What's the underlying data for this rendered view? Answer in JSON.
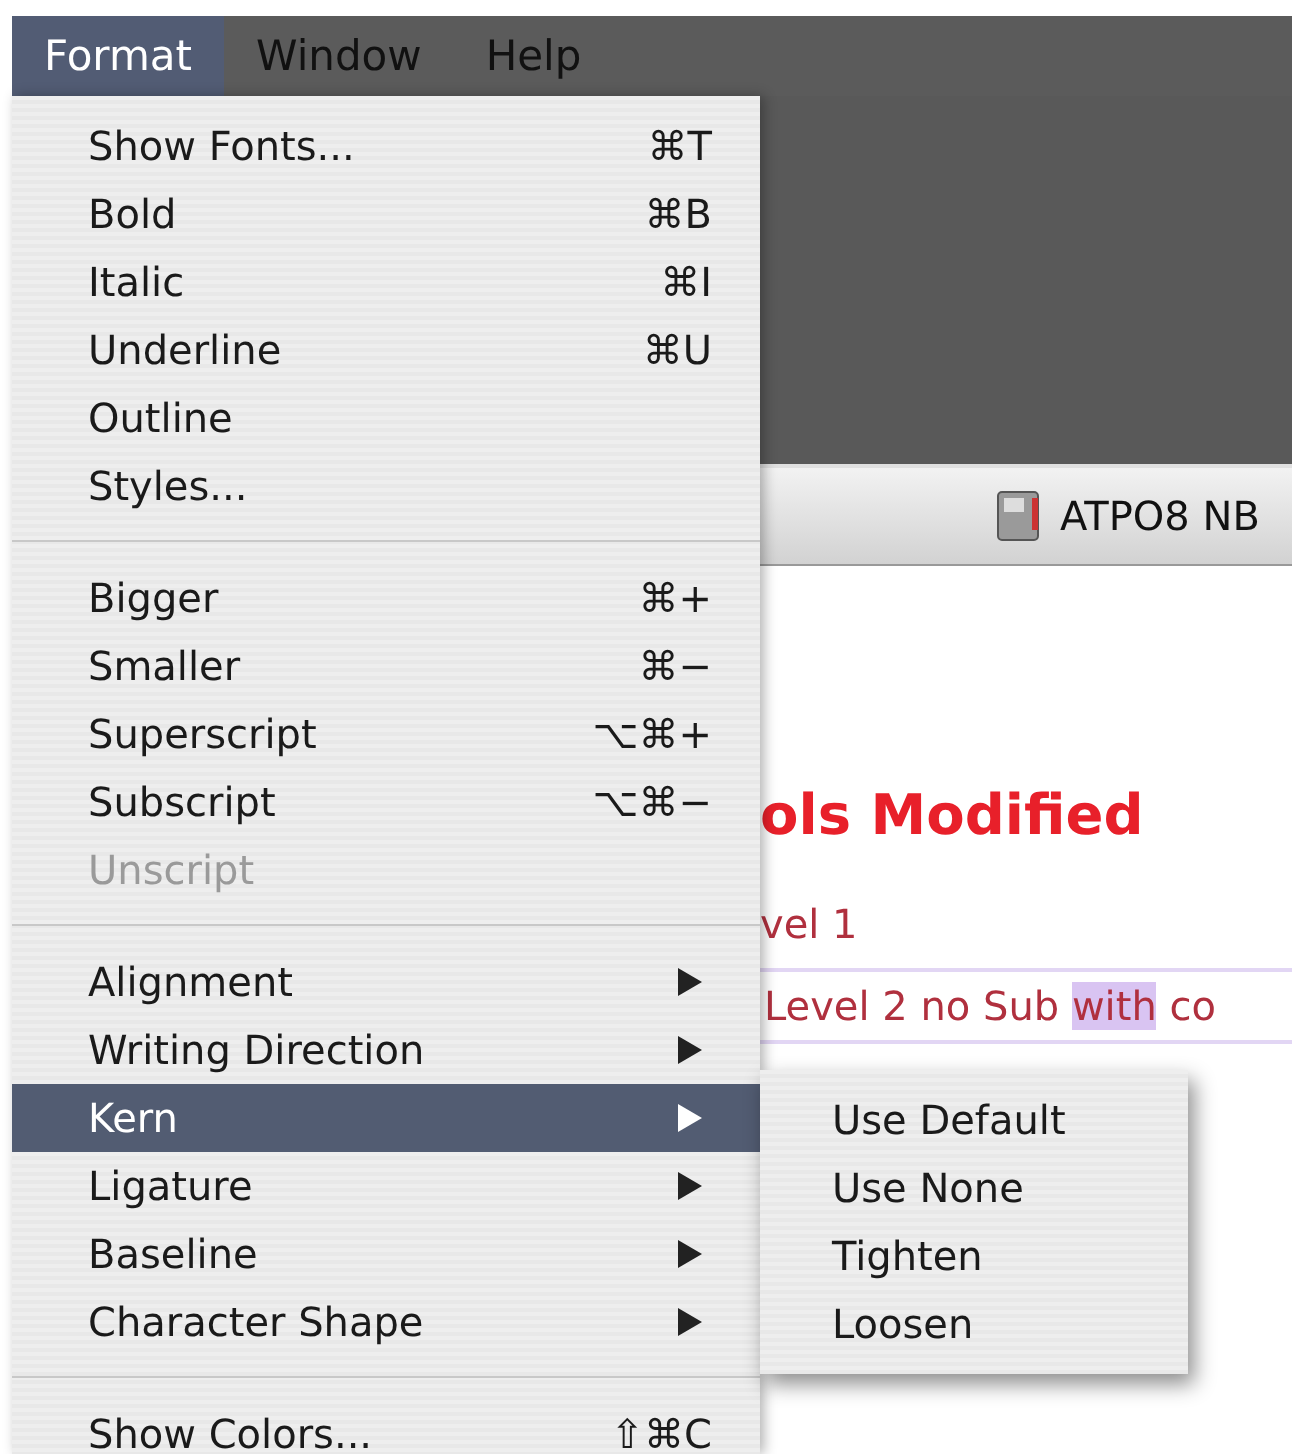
{
  "menu_bar": {
    "items": [
      {
        "label": "Format",
        "selected": true
      },
      {
        "label": "Window",
        "selected": false
      },
      {
        "label": "Help",
        "selected": false
      }
    ]
  },
  "menu": {
    "groups": [
      {
        "items": [
          {
            "label": "Show Fonts...",
            "shortcut": "⌘T",
            "submenu": false,
            "disabled": false,
            "selected": false
          },
          {
            "label": "Bold",
            "shortcut": "⌘B",
            "submenu": false,
            "disabled": false,
            "selected": false
          },
          {
            "label": "Italic",
            "shortcut": "⌘I",
            "submenu": false,
            "disabled": false,
            "selected": false
          },
          {
            "label": "Underline",
            "shortcut": "⌘U",
            "submenu": false,
            "disabled": false,
            "selected": false
          },
          {
            "label": "Outline",
            "submenu": false,
            "disabled": false,
            "selected": false
          },
          {
            "label": "Styles...",
            "submenu": false,
            "disabled": false,
            "selected": false
          }
        ]
      },
      {
        "items": [
          {
            "label": "Bigger",
            "shortcut": "⌘+",
            "submenu": false,
            "disabled": false,
            "selected": false
          },
          {
            "label": "Smaller",
            "shortcut": "⌘−",
            "submenu": false,
            "disabled": false,
            "selected": false
          },
          {
            "label": "Superscript",
            "shortcut": "⌥⌘+",
            "submenu": false,
            "disabled": false,
            "selected": false
          },
          {
            "label": "Subscript",
            "shortcut": "⌥⌘−",
            "submenu": false,
            "disabled": false,
            "selected": false
          },
          {
            "label": "Unscript",
            "submenu": false,
            "disabled": true,
            "selected": false
          }
        ]
      },
      {
        "items": [
          {
            "label": "Alignment",
            "submenu": true,
            "disabled": false,
            "selected": false
          },
          {
            "label": "Writing Direction",
            "submenu": true,
            "disabled": false,
            "selected": false
          },
          {
            "label": "Kern",
            "submenu": true,
            "disabled": false,
            "selected": true
          },
          {
            "label": "Ligature",
            "submenu": true,
            "disabled": false,
            "selected": false
          },
          {
            "label": "Baseline",
            "submenu": true,
            "disabled": false,
            "selected": false
          },
          {
            "label": "Character Shape",
            "submenu": true,
            "disabled": false,
            "selected": false
          }
        ]
      },
      {
        "items": [
          {
            "label": "Show Colors...",
            "shortcut": "⇧⌘C",
            "submenu": false,
            "disabled": false,
            "selected": false
          }
        ]
      }
    ]
  },
  "submenu": {
    "items": [
      {
        "label": "Use Default",
        "selected": false
      },
      {
        "label": "Use None",
        "selected": false
      },
      {
        "label": "Tighten",
        "selected": false
      },
      {
        "label": "Loosen",
        "selected": false
      }
    ]
  },
  "document_window": {
    "title": "ATPO8 NB",
    "heading": "ols Modified",
    "outline_item": "vel 1",
    "outline_row": [
      {
        "text": "Level 2 no Sub ",
        "highlighted": false
      },
      {
        "text": "with",
        "highlighted": true
      },
      {
        "text": " co",
        "highlighted": false
      }
    ]
  }
}
